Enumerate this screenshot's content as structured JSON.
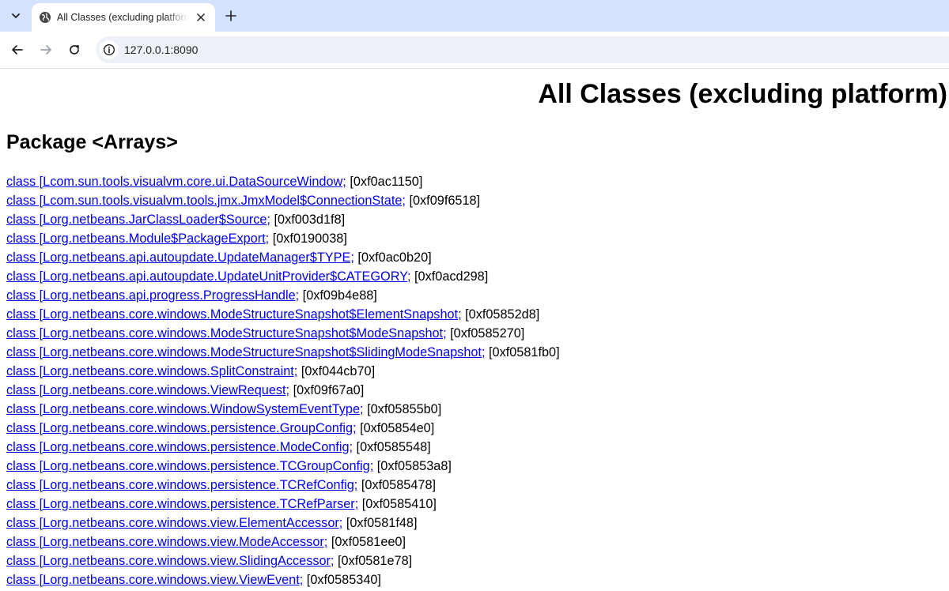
{
  "browser": {
    "tab": {
      "title": "All Classes (excluding platform)"
    },
    "address_bar": {
      "url": "127.0.0.1:8090"
    },
    "icons": {
      "tab_search": "chevron-down-icon",
      "favicon": "globe-icon",
      "close": "close-icon",
      "new_tab": "plus-icon",
      "back": "arrow-left-icon",
      "forward": "arrow-right-icon",
      "reload": "reload-icon",
      "site_info": "site-info-icon"
    }
  },
  "page": {
    "title": "All Classes (excluding platform)",
    "package_heading": "Package <Arrays>",
    "classes": [
      {
        "link": "class [Lcom.sun.tools.visualvm.core.ui.DataSourceWindow;",
        "addr": " [0xf0ac1150]"
      },
      {
        "link": "class [Lcom.sun.tools.visualvm.tools.jmx.JmxModel$ConnectionState;",
        "addr": " [0xf09f6518]"
      },
      {
        "link": "class [Lorg.netbeans.JarClassLoader$Source;",
        "addr": " [0xf003d1f8]"
      },
      {
        "link": "class [Lorg.netbeans.Module$PackageExport;",
        "addr": " [0xf0190038]"
      },
      {
        "link": "class [Lorg.netbeans.api.autoupdate.UpdateManager$TYPE;",
        "addr": " [0xf0ac0b20]"
      },
      {
        "link": "class [Lorg.netbeans.api.autoupdate.UpdateUnitProvider$CATEGORY;",
        "addr": " [0xf0acd298]"
      },
      {
        "link": "class [Lorg.netbeans.api.progress.ProgressHandle;",
        "addr": " [0xf09b4e88]"
      },
      {
        "link": "class [Lorg.netbeans.core.windows.ModeStructureSnapshot$ElementSnapshot;",
        "addr": " [0xf05852d8]"
      },
      {
        "link": "class [Lorg.netbeans.core.windows.ModeStructureSnapshot$ModeSnapshot;",
        "addr": " [0xf0585270]"
      },
      {
        "link": "class [Lorg.netbeans.core.windows.ModeStructureSnapshot$SlidingModeSnapshot;",
        "addr": " [0xf0581fb0]"
      },
      {
        "link": "class [Lorg.netbeans.core.windows.SplitConstraint;",
        "addr": " [0xf044cb70]"
      },
      {
        "link": "class [Lorg.netbeans.core.windows.ViewRequest;",
        "addr": " [0xf09f67a0]"
      },
      {
        "link": "class [Lorg.netbeans.core.windows.WindowSystemEventType;",
        "addr": " [0xf05855b0]"
      },
      {
        "link": "class [Lorg.netbeans.core.windows.persistence.GroupConfig;",
        "addr": " [0xf05854e0]"
      },
      {
        "link": "class [Lorg.netbeans.core.windows.persistence.ModeConfig;",
        "addr": " [0xf0585548]"
      },
      {
        "link": "class [Lorg.netbeans.core.windows.persistence.TCGroupConfig;",
        "addr": " [0xf05853a8]"
      },
      {
        "link": "class [Lorg.netbeans.core.windows.persistence.TCRefConfig;",
        "addr": " [0xf0585478]"
      },
      {
        "link": "class [Lorg.netbeans.core.windows.persistence.TCRefParser;",
        "addr": " [0xf0585410]"
      },
      {
        "link": "class [Lorg.netbeans.core.windows.view.ElementAccessor;",
        "addr": " [0xf0581f48]"
      },
      {
        "link": "class [Lorg.netbeans.core.windows.view.ModeAccessor;",
        "addr": " [0xf0581ee0]"
      },
      {
        "link": "class [Lorg.netbeans.core.windows.view.SlidingAccessor;",
        "addr": " [0xf0581e78]"
      },
      {
        "link": "class [Lorg.netbeans.core.windows.view.ViewEvent;",
        "addr": " [0xf0585340]"
      }
    ]
  },
  "colors": {
    "tabstrip": "#d3e3fd",
    "link": "#0000ee",
    "omnibox": "#eef1f7"
  }
}
